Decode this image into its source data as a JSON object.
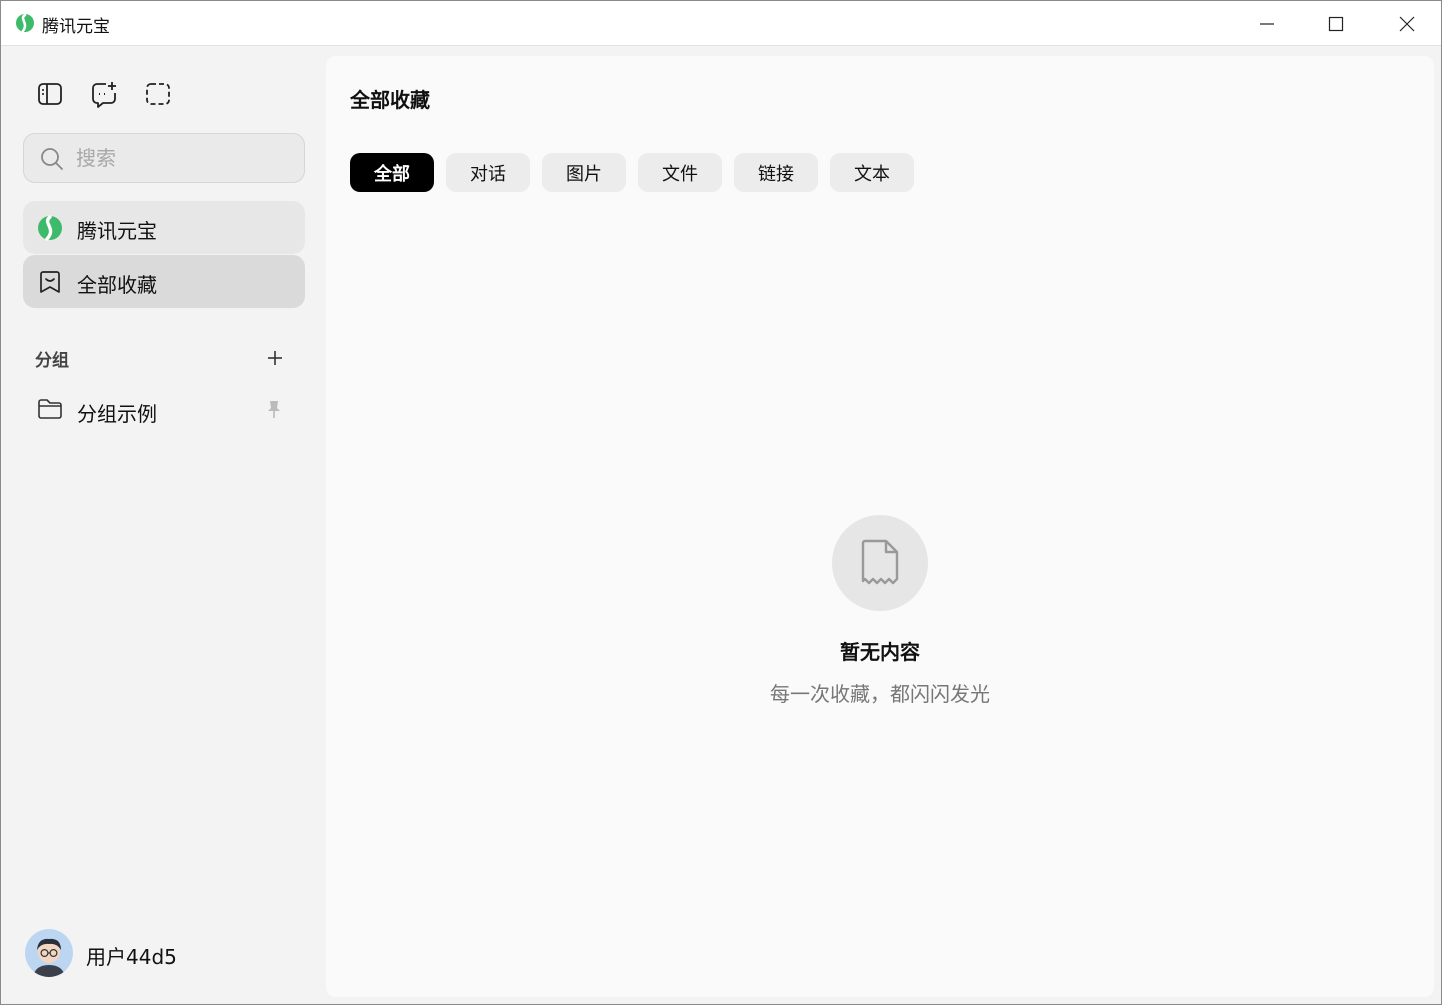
{
  "window": {
    "title": "腾讯元宝"
  },
  "sidebar": {
    "search": {
      "placeholder": "搜索"
    },
    "nav": [
      {
        "label": "腾讯元宝"
      },
      {
        "label": "全部收藏"
      }
    ],
    "groups": {
      "section_label": "分组",
      "items": [
        {
          "label": "分组示例"
        }
      ]
    },
    "user": {
      "name": "用户44d5"
    }
  },
  "main": {
    "title": "全部收藏",
    "tabs": [
      {
        "label": "全部",
        "active": true
      },
      {
        "label": "对话",
        "active": false
      },
      {
        "label": "图片",
        "active": false
      },
      {
        "label": "文件",
        "active": false
      },
      {
        "label": "链接",
        "active": false
      },
      {
        "label": "文本",
        "active": false
      }
    ],
    "empty": {
      "title": "暂无内容",
      "subtitle": "每一次收藏，都闪闪发光"
    }
  },
  "colors": {
    "brand_green": "#3dba6a",
    "active_tab_bg": "#000000",
    "sidebar_bg": "#f3f3f3"
  }
}
